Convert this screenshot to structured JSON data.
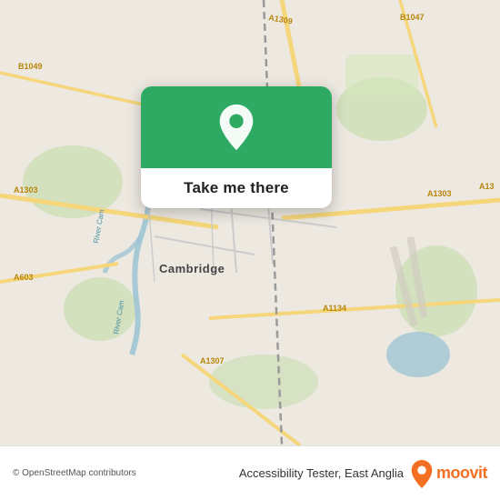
{
  "map": {
    "alt": "OpenStreetMap of Cambridge, East Anglia"
  },
  "card": {
    "button_label": "Take me there"
  },
  "bottom": {
    "attribution": "© OpenStreetMap contributors",
    "app_name": "Accessibility Tester, East Anglia",
    "moovit_label": "moovit"
  }
}
